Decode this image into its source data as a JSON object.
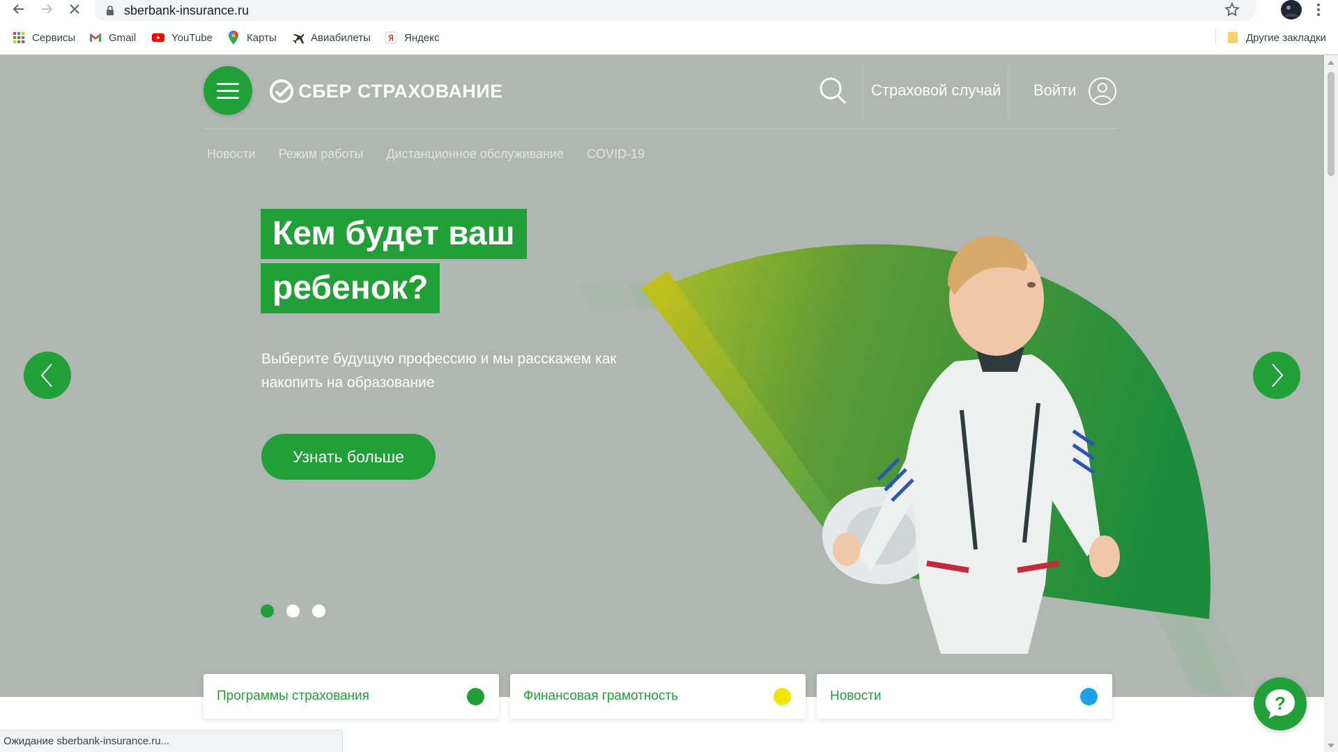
{
  "browser": {
    "url": "sberbank-insurance.ru",
    "bookmarks": [
      {
        "label": "Сервисы",
        "icon": "apps-grid-icon"
      },
      {
        "label": "Gmail",
        "icon": "gmail-icon"
      },
      {
        "label": "YouTube",
        "icon": "youtube-icon"
      },
      {
        "label": "Карты",
        "icon": "maps-pin-icon"
      },
      {
        "label": "Авиабилеты",
        "icon": "airplane-icon"
      },
      {
        "label": "Яндекс",
        "icon": "yandex-icon"
      }
    ],
    "other_bookmarks": "Другие закладки",
    "status_text": "Ожидание sberbank-insurance.ru..."
  },
  "header": {
    "logo_text": "СБЕР СТРАХОВАНИЕ",
    "claim_link": "Страховой случай",
    "login_link": "Войти"
  },
  "subnav": [
    "Новости",
    "Режим работы",
    "Дистанционное обслуживание",
    "COVID-19"
  ],
  "hero": {
    "title_line1": "Кем будет ваш",
    "title_line2": "ребенок?",
    "subtitle": "Выберите будущую профессию и мы расскажем как накопить на образование",
    "cta_label": "Узнать больше",
    "slide_count": 3,
    "active_slide": 1
  },
  "cards": [
    {
      "label": "Программы страхования",
      "dot_color": "#21a038"
    },
    {
      "label": "Финансовая грамотность",
      "dot_color": "#f2e600"
    },
    {
      "label": "Новости",
      "dot_color": "#1aa3e8"
    }
  ],
  "colors": {
    "brand_green": "#21a038",
    "hero_background": "#b0b6b2"
  }
}
